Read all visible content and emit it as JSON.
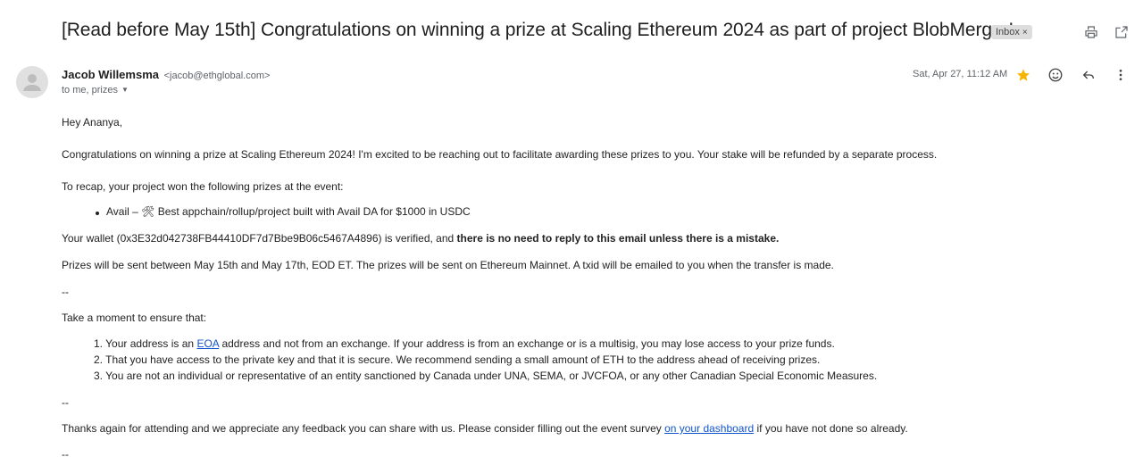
{
  "email": {
    "subject": "[Read before May 15th] Congratulations on winning a prize at Scaling Ethereum 2024 as part of project BlobMerger!",
    "label": "Inbox",
    "label_close": "×",
    "sender_name": "Jacob Willemsma",
    "sender_email": "<jacob@ethglobal.com>",
    "recipients": "to me, prizes",
    "date": "Sat, Apr 27, 11:12 AM",
    "starred": true
  },
  "icons": {
    "print": "printer-icon",
    "popout": "open-in-new-window-icon",
    "star": "star-icon",
    "emoji": "smiley-icon",
    "reply": "reply-icon",
    "more": "more-vertical-icon",
    "avatar": "person-icon",
    "dropdown": "caret-down-icon"
  },
  "colors": {
    "star": "#f4b400",
    "link": "#1155cc",
    "chip_bg": "#dddddd"
  },
  "body": {
    "greeting": "Hey Ananya,",
    "intro": "Congratulations on winning a prize at Scaling Ethereum 2024! I'm excited to be reaching out to facilitate awarding these prizes to you. Your stake will be refunded by a separate process.",
    "recap": "To recap, your project won the following prizes at the event:",
    "prize": "Avail – 🛠 Best appchain/rollup/project built with Avail DA for $1000 in USDC",
    "wallet_text": "Your wallet (0x3E32d042738FB44410DF7d7Bbe9B06c5467A4896) is verified, and ",
    "wallet_bold": "there is no need to reply to this email unless there is a mistake.",
    "schedule": "Prizes will be sent between May 15th and May 17th, EOD ET. The prizes will be sent on Ethereum Mainnet. A txid will be emailed to you when the transfer is made.",
    "separator": "--",
    "ensure_intro": "Take a moment to ensure that:",
    "item1_num": "1.",
    "item1_pre": "Your address is an ",
    "item1_link": "EOA",
    "item1_post": " address and not from an exchange. If your address is from an exchange or is a multisig, you may lose access to your prize funds.",
    "item2_num": "2.",
    "item2": "That you have access to the private key and that it is secure. We recommend sending a small amount of ETH to the address ahead of receiving prizes.",
    "item3_num": "3.",
    "item3": "You are not an individual or representative of an entity sanctioned by Canada under UNA, SEMA, or JVCFOA, or any other Canadian Special Economic Measures.",
    "thanks_pre": "Thanks again for attending and we appreciate any feedback you can share with us. Please consider filling out the event survey ",
    "thanks_link": "on your dashboard",
    "thanks_post": " if you have not done so already."
  }
}
